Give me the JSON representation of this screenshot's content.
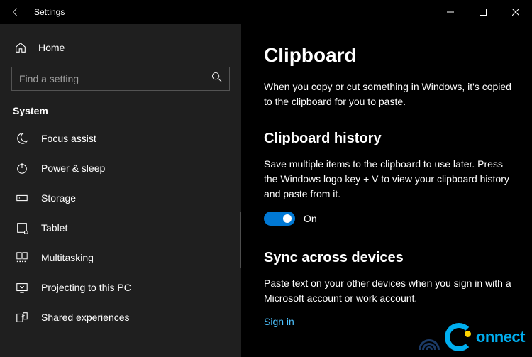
{
  "window": {
    "title": "Settings"
  },
  "sidebar": {
    "home_label": "Home",
    "search_placeholder": "Find a setting",
    "category": "System",
    "items": [
      {
        "icon": "moon-icon",
        "label": "Focus assist"
      },
      {
        "icon": "power-icon",
        "label": "Power & sleep"
      },
      {
        "icon": "storage-icon",
        "label": "Storage"
      },
      {
        "icon": "tablet-icon",
        "label": "Tablet"
      },
      {
        "icon": "multitask-icon",
        "label": "Multitasking"
      },
      {
        "icon": "projecting-icon",
        "label": "Projecting to this PC"
      },
      {
        "icon": "shared-icon",
        "label": "Shared experiences"
      }
    ]
  },
  "main": {
    "title": "Clipboard",
    "intro": "When you copy or cut something in Windows, it's copied to the clipboard for you to paste.",
    "history": {
      "title": "Clipboard history",
      "desc": "Save multiple items to the clipboard to use later. Press the Windows logo key + V to view your clipboard history and paste from it.",
      "toggle_state": "On",
      "toggle_on": true
    },
    "sync": {
      "title": "Sync across devices",
      "desc": "Paste text on your other devices when you sign in with a Microsoft account or work account.",
      "link": "Sign in"
    }
  },
  "watermark": {
    "text": "onnect"
  }
}
